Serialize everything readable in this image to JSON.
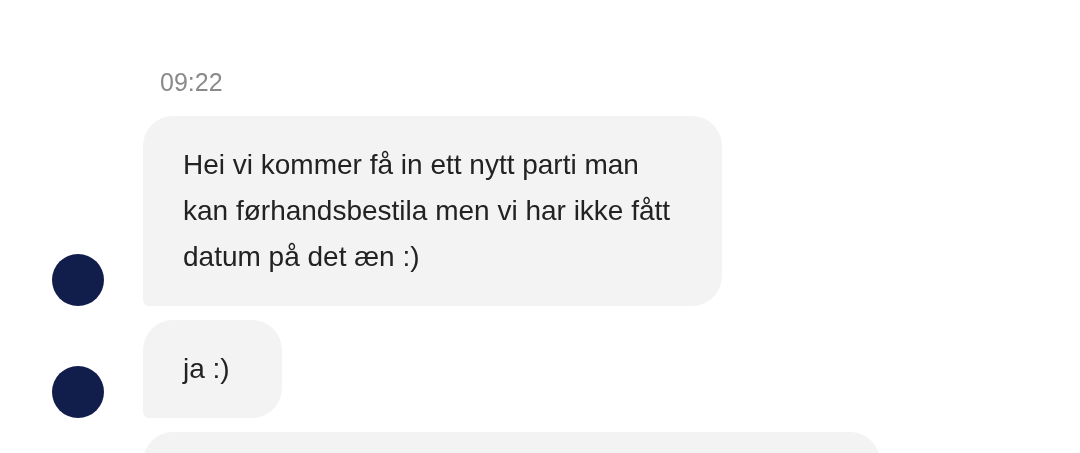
{
  "timestamp": "09:22",
  "messages": [
    {
      "text": "Hei vi kommer få in ett nytt parti man\nkan førhandsbestila men vi har ikke fått\ndatum på det æn :)"
    },
    {
      "text": "ja :)"
    }
  ],
  "next_message_partly_visible": true
}
